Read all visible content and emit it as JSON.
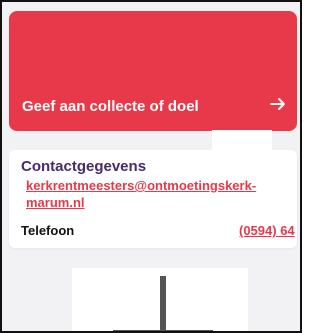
{
  "donate": {
    "label": "Geef aan collecte of doel",
    "icon": "arrow-right-icon",
    "color": "#e8394a"
  },
  "contact": {
    "title": "Contactgegevens",
    "email": "kerkrentmeesters@ontmoetingskerk-marum.nl",
    "phone_label": "Telefoon",
    "phone_value": "(0594) 64",
    "title_color": "#4a2a6b",
    "link_color": "#e8394a"
  },
  "image": {
    "icon": "cross-icon"
  }
}
